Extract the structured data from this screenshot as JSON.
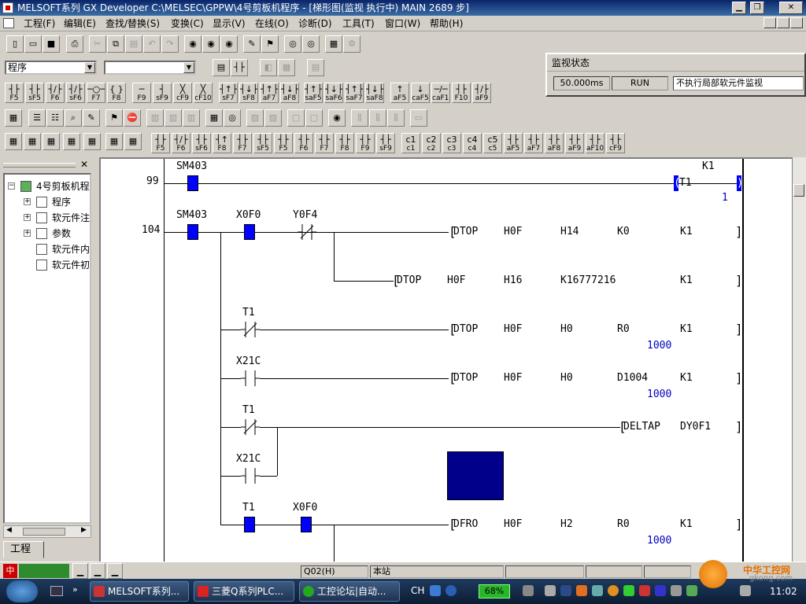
{
  "window": {
    "title": "MELSOFT系列 GX Developer C:\\MELSEC\\GPPW\\4号剪板机程序 - [梯形图(监视 执行中)     MAIN     2689 步]",
    "min_label": "▁",
    "max_label": "❐",
    "close_label": "✕"
  },
  "menu": [
    "工程(F)",
    "编辑(E)",
    "查找/替换(S)",
    "变换(C)",
    "显示(V)",
    "在线(O)",
    "诊断(D)",
    "工具(T)",
    "窗口(W)",
    "帮助(H)"
  ],
  "toolbar": {
    "combo1_value": "程序",
    "combo2_value": ""
  },
  "fkeys_row1": [
    {
      "sym": "┤├",
      "label": "F5"
    },
    {
      "sym": "┤├",
      "label": "sF5"
    },
    {
      "sym": "┤/├",
      "label": "F6"
    },
    {
      "sym": "┤/├",
      "label": "sF6"
    },
    {
      "sym": "─○─",
      "label": "F7"
    },
    {
      "sym": "{ }",
      "label": "F8"
    },
    {
      "sym": "─",
      "label": "F9"
    },
    {
      "sym": "┤",
      "label": "sF9"
    },
    {
      "sym": "╳",
      "label": "cF9"
    },
    {
      "sym": "╳",
      "label": "cF10"
    },
    {
      "sym": "┤↑├",
      "label": "sF7"
    },
    {
      "sym": "┤↓├",
      "label": "sF8"
    },
    {
      "sym": "┤↑├",
      "label": "aF7"
    },
    {
      "sym": "┤↓├",
      "label": "aF8"
    },
    {
      "sym": "┤↑├",
      "label": "saF5"
    },
    {
      "sym": "┤↓├",
      "label": "saF6"
    },
    {
      "sym": "┤↑├",
      "label": "saF7"
    },
    {
      "sym": "┤↓├",
      "label": "saF8"
    },
    {
      "sym": "↑",
      "label": "aF5"
    },
    {
      "sym": "↓",
      "label": "caF5"
    },
    {
      "sym": "─/─",
      "label": "caF10"
    },
    {
      "sym": "┤├",
      "label": "F10"
    },
    {
      "sym": "┤/├",
      "label": "aF9"
    }
  ],
  "fkeys_row3": [
    {
      "sym": "┤├",
      "label": "F5"
    },
    {
      "sym": "┤/├",
      "label": "F6"
    },
    {
      "sym": "┤├",
      "label": "sF6"
    },
    {
      "sym": "┤↑",
      "label": "F8"
    },
    {
      "sym": "┤├",
      "label": "F7"
    },
    {
      "sym": "┤├",
      "label": "sF5"
    },
    {
      "sym": "┤├",
      "label": "F5"
    },
    {
      "sym": "┤├",
      "label": "F6"
    },
    {
      "sym": "┤├",
      "label": "F7"
    },
    {
      "sym": "┤├",
      "label": "F8"
    },
    {
      "sym": "┤├",
      "label": "F9"
    },
    {
      "sym": "┤├",
      "label": "sF9"
    },
    {
      "sym": "c1",
      "label": "c1"
    },
    {
      "sym": "c2",
      "label": "c2"
    },
    {
      "sym": "c3",
      "label": "c3"
    },
    {
      "sym": "c4",
      "label": "c4"
    },
    {
      "sym": "c5",
      "label": "c5"
    },
    {
      "sym": "┤├",
      "label": "aF5"
    },
    {
      "sym": "┤├",
      "label": "aF7"
    },
    {
      "sym": "┤├",
      "label": "aF8"
    },
    {
      "sym": "┤├",
      "label": "aF9"
    },
    {
      "sym": "┤├",
      "label": "aF10"
    },
    {
      "sym": "┤├",
      "label": "cF9"
    }
  ],
  "monitor": {
    "title": "监视状态",
    "scan_time": "50.000ms",
    "state": "RUN",
    "mode_value": "不执行局部软元件监视"
  },
  "project_tree": {
    "root": "4号剪板机程",
    "items": [
      "程序",
      "软元件注",
      "参数",
      "软元件内",
      "软元件初"
    ],
    "tab": "工程"
  },
  "ladder": {
    "step1": "99",
    "step2": "104",
    "sm403_a": "SM403",
    "k1_top": "K1",
    "timer": "T1",
    "timer_value": "1",
    "sm403_b": "SM403",
    "x0f0": "X0F0",
    "y0f4": "Y0F4",
    "r1": {
      "cmd": "DTOP",
      "a": "H0F",
      "b": "H14",
      "c": "K0",
      "d": "K1"
    },
    "r2": {
      "cmd": "DTOP",
      "a": "H0F",
      "b": "H16",
      "c": "K16777216",
      "d": "K1"
    },
    "t1_a": "T1",
    "r3": {
      "cmd": "DTOP",
      "a": "H0F",
      "b": "H0",
      "c": "R0",
      "d": "K1",
      "val": "1000"
    },
    "x21c_a": "X21C",
    "r4": {
      "cmd": "DTOP",
      "a": "H0F",
      "b": "H0",
      "c": "D1004",
      "d": "K1",
      "val": "1000"
    },
    "t1_b": "T1",
    "r5": {
      "cmd": "DELTAP",
      "a": "DY0F1"
    },
    "x21c_b": "X21C",
    "t1_c": "T1",
    "x0f0_b": "X0F0",
    "r6": {
      "cmd": "DFRO",
      "a": "H0F",
      "b": "H2",
      "c": "R0",
      "d": "K1",
      "val": "1000"
    }
  },
  "statusbar": {
    "cpu": "Q02(H)",
    "station": "本站"
  },
  "taskbar": {
    "items": [
      "MELSOFT系列...",
      "三菱Q系列PLC...",
      "工控论坛|自动..."
    ],
    "lang": "CH",
    "battery": "68%",
    "clock": "11:02",
    "watermark_main": "中华工控网",
    "watermark_sub": "gkong.com"
  },
  "colors": {
    "contact_on": "#0000ff",
    "title_start": "#0a246a",
    "title_end": "#3a6ea5",
    "value_text": "#0000c0"
  }
}
